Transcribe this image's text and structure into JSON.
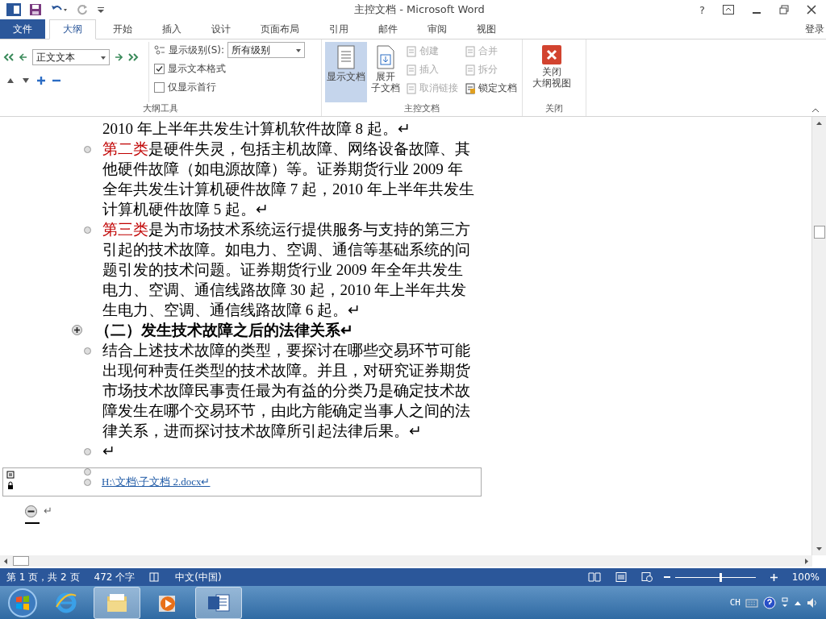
{
  "title_bar": {
    "title": "主控文档 - Microsoft Word",
    "help": "?"
  },
  "tabs": [
    {
      "label": "文件",
      "kind": "file",
      "selected": false
    },
    {
      "label": "大纲",
      "kind": "tab",
      "selected": true
    },
    {
      "label": "开始",
      "kind": "tab",
      "selected": false
    },
    {
      "label": "插入",
      "kind": "tab",
      "selected": false
    },
    {
      "label": "设计",
      "kind": "tab",
      "selected": false
    },
    {
      "label": "页面布局",
      "kind": "tab",
      "selected": false
    },
    {
      "label": "引用",
      "kind": "tab",
      "selected": false
    },
    {
      "label": "邮件",
      "kind": "tab",
      "selected": false
    },
    {
      "label": "审阅",
      "kind": "tab",
      "selected": false
    },
    {
      "label": "视图",
      "kind": "tab",
      "selected": false
    }
  ],
  "sign_in": "登录",
  "outline_tools": {
    "style_value": "正文文本",
    "show_level_label": "显示级别(S):",
    "level_value": "所有级别",
    "checkboxes": [
      {
        "label": "显示文本格式",
        "checked": true
      },
      {
        "label": "仅显示首行",
        "checked": false
      }
    ],
    "group_label": "大纲工具"
  },
  "master_document": {
    "big_buttons": [
      {
        "label_lines": [
          "显示文档"
        ],
        "selected": true,
        "kind": "show"
      },
      {
        "label_lines": [
          "展开",
          "子文档"
        ],
        "selected": false,
        "kind": "expand"
      }
    ],
    "small_buttons": [
      {
        "label": "创建",
        "disabled": true
      },
      {
        "label": "插入",
        "disabled": true
      },
      {
        "label": "取消链接",
        "disabled": true
      },
      {
        "label": "合并",
        "disabled": true
      },
      {
        "label": "拆分",
        "disabled": true
      },
      {
        "label": "锁定文档",
        "disabled": false
      }
    ],
    "group_label": "主控文档"
  },
  "close_group": {
    "button_lines": [
      "关闭",
      "大纲视图"
    ],
    "group_label": "关闭"
  },
  "document": [
    {
      "kind": "continuation",
      "text": "2010 年上半年共发生计算机软件故障 8 起。↵"
    },
    {
      "kind": "body",
      "lead": "第二类",
      "text": "是硬件失灵，包括主机故障、网络设备故障、其他硬件故障（如电源故障）等。证券期货行业 2009 年全年共发生计算机硬件故障 7 起，2010 年上半年共发生计算机硬件故障 5 起。↵"
    },
    {
      "kind": "body",
      "lead": "第三类",
      "text": "是为市场技术系统运行提供服务与支持的第三方引起的技术故障。如电力、空调、通信等基础系统的问题引发的技术问题。证券期货行业 2009 年全年共发生电力、空调、通信线路故障 30 起，2010 年上半年共发生电力、空调、通信线路故障 6 起。↵"
    },
    {
      "kind": "heading",
      "text": "（二）发生技术故障之后的法律关系↵"
    },
    {
      "kind": "body",
      "text": "结合上述技术故障的类型，要探讨在哪些交易环节可能出现何种责任类型的技术故障。并且，对研究证券期货市场技术故障民事责任最为有益的分类乃是确定技术故障发生在哪个交易环节，由此方能确定当事人之间的法律关系，进而探讨技术故障所引起法律后果。↵"
    },
    {
      "kind": "body",
      "text": "↵"
    },
    {
      "kind": "body"
    }
  ],
  "subdocument": {
    "locked": true,
    "link": "H:\\文档\\子文档 2.docx↵"
  },
  "end_paragraph": {
    "mark": "↵"
  },
  "status_bar": {
    "page": "第 1 页，共 2 页",
    "words": "472 个字",
    "language": "中文(中国)",
    "zoom_slider": {
      "level": 0.55
    },
    "zoom": "100%"
  },
  "taskbar": {
    "apps": [
      {
        "kind": "ie",
        "selected": false
      },
      {
        "kind": "explorer",
        "selected": true
      },
      {
        "kind": "media",
        "selected": false
      },
      {
        "kind": "word",
        "selected": true
      }
    ],
    "input_lang": "CH"
  }
}
